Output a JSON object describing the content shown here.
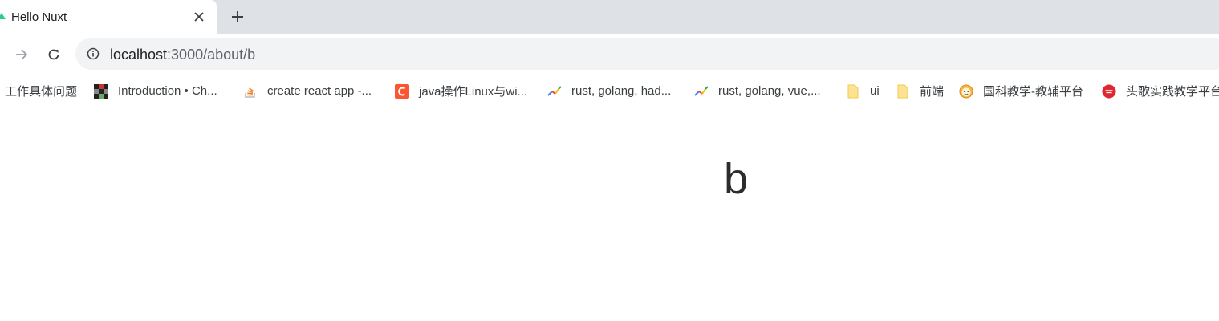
{
  "tab": {
    "title": "Hello Nuxt",
    "favicon": "nuxt-icon",
    "close_icon": "close-icon",
    "new_tab_icon": "plus-icon"
  },
  "toolbar": {
    "forward_icon": "arrow-right-icon",
    "reload_icon": "reload-icon",
    "site_info_icon": "info-icon",
    "url_host": "localhost",
    "url_rest": ":3000/about/b"
  },
  "bookmarks": [
    {
      "label": "工作具体问题",
      "icon": "none"
    },
    {
      "label": "Introduction • Ch...",
      "icon": "pixel-favicon-icon"
    },
    {
      "label": "create react app -...",
      "icon": "stackoverflow-icon"
    },
    {
      "label": "java操作Linux与wi...",
      "icon": "csdn-icon"
    },
    {
      "label": "rust, golang, had...",
      "icon": "trend-icon"
    },
    {
      "label": "rust, golang, vue,...",
      "icon": "trend-icon"
    },
    {
      "label": "ui",
      "icon": "folder-icon"
    },
    {
      "label": "前端",
      "icon": "folder-icon"
    },
    {
      "label": "国科教学-教辅平台",
      "icon": "mascot-icon"
    },
    {
      "label": "头歌实践教学平台",
      "icon": "toutiao-icon"
    }
  ],
  "page": {
    "text": "b"
  },
  "colors": {
    "tabstrip": "#dee1e6",
    "omnibox": "#f1f3f4",
    "nuxt_green": "#2fcb8b",
    "csdn_red": "#fc5531",
    "folder_yellow": "#fde293",
    "toutiao_red": "#e0262e"
  }
}
